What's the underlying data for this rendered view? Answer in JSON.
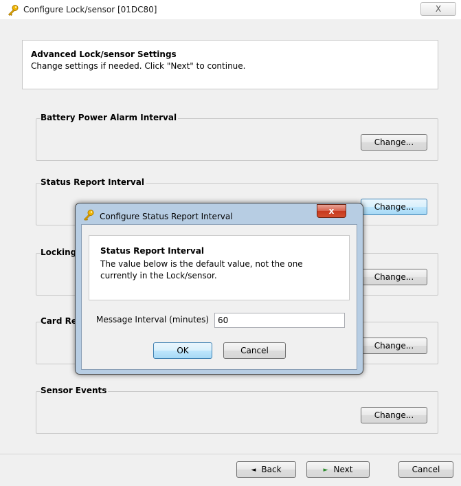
{
  "window": {
    "title": "Configure Lock/sensor [01DC80]",
    "close_symbol": "X"
  },
  "header": {
    "title": "Advanced Lock/sensor Settings",
    "subtitle": "Change settings if needed. Click \"Next\" to continue."
  },
  "groups": [
    {
      "legend": "Battery Power Alarm Interval",
      "button": "Change..."
    },
    {
      "legend": "Status Report Interval",
      "button": "Change..."
    },
    {
      "legend": "Locking",
      "button": "Change..."
    },
    {
      "legend": "Card Re",
      "button": "Change..."
    },
    {
      "legend": "Sensor Events",
      "button": "Change..."
    }
  ],
  "footer": {
    "back_label": "Back",
    "next_label": "Next",
    "cancel_label": "Cancel"
  },
  "dialog": {
    "title": "Configure Status Report Interval",
    "close_symbol": "x",
    "info_title": "Status Report Interval",
    "info_text": "The value below is the default value, not the one currently in the Lock/sensor.",
    "field_label": "Message Interval (minutes)",
    "field_value": "60",
    "ok_label": "OK",
    "cancel_label": "Cancel"
  },
  "icons": {
    "title_icon": "key-icon",
    "back_arrow": "arrow-left-icon",
    "next_arrow": "arrow-right-icon"
  },
  "colors": {
    "dialog_frame": "#b7cde3",
    "close_button_red": "#c7391d",
    "hover_button_blue": "#bee6fd"
  }
}
